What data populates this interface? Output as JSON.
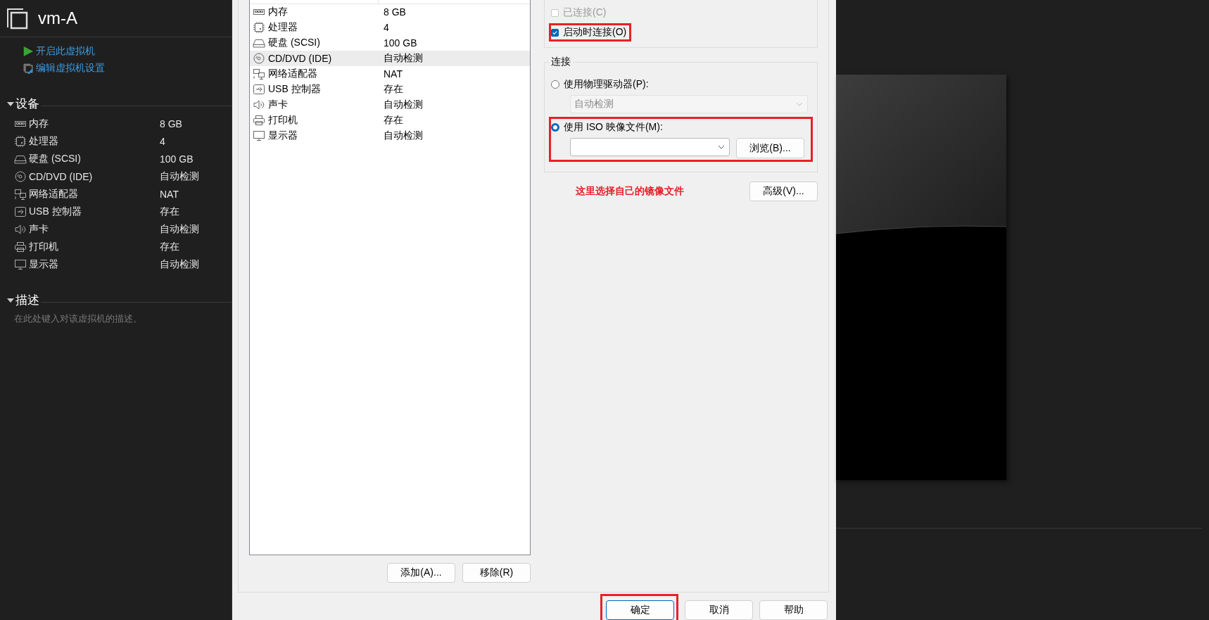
{
  "vm": {
    "title": "vm-A",
    "actions": [
      {
        "kind": "power-on",
        "label": "开启此虚拟机"
      },
      {
        "kind": "edit",
        "label": "编辑虚拟机设置"
      }
    ],
    "devices_section": {
      "title": "设备",
      "expanded": true,
      "devices": [
        {
          "kind": "memory",
          "name": "内存",
          "summary": "8 GB"
        },
        {
          "kind": "cpu",
          "name": "处理器",
          "summary": "4"
        },
        {
          "kind": "disk",
          "name": "硬盘 (SCSI)",
          "summary": "100 GB"
        },
        {
          "kind": "cdrom",
          "name": "CD/DVD (IDE)",
          "summary": "自动检测"
        },
        {
          "kind": "network",
          "name": "网络适配器",
          "summary": "NAT"
        },
        {
          "kind": "usb",
          "name": "USB 控制器",
          "summary": "存在"
        },
        {
          "kind": "sound",
          "name": "声卡",
          "summary": "自动检测"
        },
        {
          "kind": "printer",
          "name": "打印机",
          "summary": "存在"
        },
        {
          "kind": "display",
          "name": "显示器",
          "summary": "自动检测"
        }
      ]
    },
    "description_section": {
      "title": "描述",
      "expanded": true,
      "placeholder": "在此处键入对该虚拟机的描述。"
    }
  },
  "dialog": {
    "device_list": {
      "rows": [
        {
          "kind": "memory",
          "name": "内存",
          "summary": "8 GB",
          "selected": false
        },
        {
          "kind": "cpu",
          "name": "处理器",
          "summary": "4",
          "selected": false
        },
        {
          "kind": "disk",
          "name": "硬盘 (SCSI)",
          "summary": "100 GB",
          "selected": false
        },
        {
          "kind": "cdrom",
          "name": "CD/DVD (IDE)",
          "summary": "自动检测",
          "selected": true
        },
        {
          "kind": "network",
          "name": "网络适配器",
          "summary": "NAT",
          "selected": false
        },
        {
          "kind": "usb",
          "name": "USB 控制器",
          "summary": "存在",
          "selected": false
        },
        {
          "kind": "sound",
          "name": "声卡",
          "summary": "自动检测",
          "selected": false
        },
        {
          "kind": "printer",
          "name": "打印机",
          "summary": "存在",
          "selected": false
        },
        {
          "kind": "display",
          "name": "显示器",
          "summary": "自动检测",
          "selected": false
        }
      ]
    },
    "list_buttons": [
      "添加(A)...",
      "移除(R)"
    ],
    "device_status": {
      "options": [
        {
          "label": "已连接(C)",
          "checked": false,
          "disabled": true,
          "annotated": false
        },
        {
          "label": "启动时连接(O)",
          "checked": true,
          "disabled": false,
          "annotated": true
        }
      ]
    },
    "connection": {
      "title": "连接",
      "options": [
        {
          "label": "使用物理驱动器(P):",
          "selected": false,
          "annotated": false,
          "field": {
            "value": "自动检测",
            "disabled": true
          }
        },
        {
          "label": "使用 ISO 映像文件(M):",
          "selected": true,
          "annotated": true,
          "field": {
            "disabled": false
          },
          "browse_button": "浏览(B)..."
        }
      ]
    },
    "note": "这里选择自己的镜像文件",
    "advanced_button": "高级(V)...",
    "footer_buttons": [
      {
        "label": "确定",
        "default": true,
        "annotated": true
      },
      {
        "label": "取消",
        "default": false,
        "annotated": false
      },
      {
        "label": "帮助",
        "default": false,
        "annotated": false
      }
    ]
  }
}
